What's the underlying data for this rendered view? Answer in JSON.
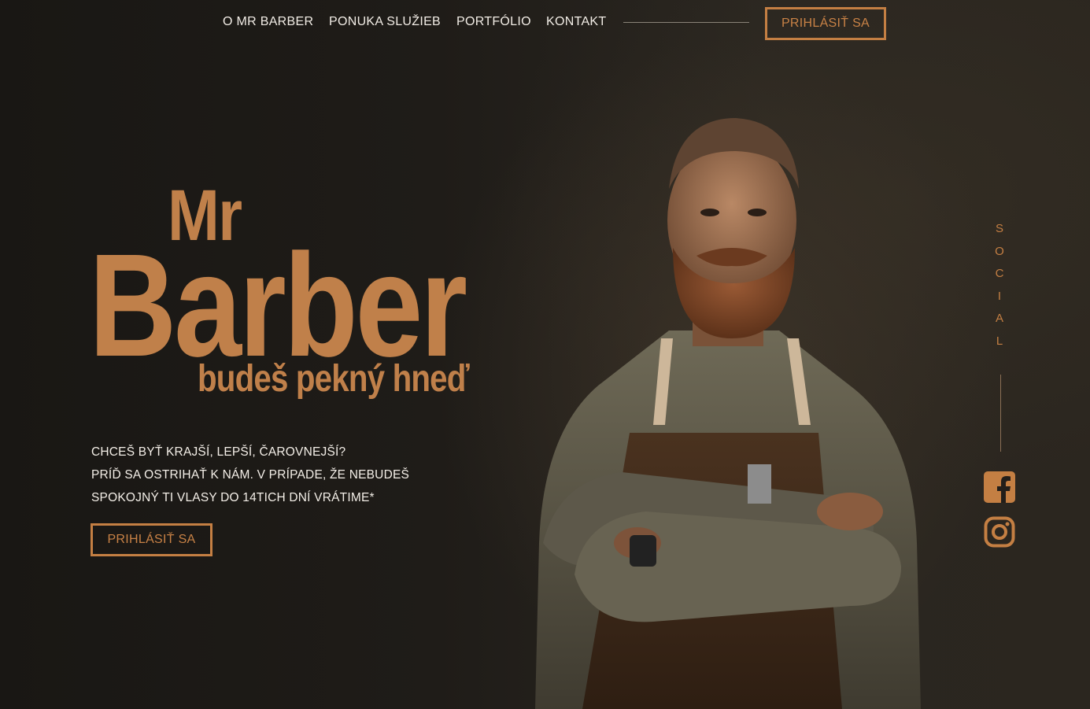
{
  "nav": {
    "links": [
      {
        "label": "O MR BARBER"
      },
      {
        "label": "PONUKA SLUŽIEB"
      },
      {
        "label": "PORTFÓLIO"
      },
      {
        "label": "KONTAKT"
      }
    ],
    "login_label": "PRIHLÁSIŤ SA"
  },
  "hero": {
    "title_small": "Mr",
    "title_big": "Barber",
    "subtitle": "budeš pekný hneď",
    "description": [
      "CHCEŠ BYŤ KRAJŠÍ, LEPŠÍ, ČAROVNEJŠÍ?",
      "PRÍĎ SA OSTRIHAŤ K NÁM. V PRÍPADE, ŽE NEBUDEŠ",
      "SPOKOJNÝ TI VLASY DO 14TICH DNÍ VRÁTIME*"
    ],
    "cta_label": "PRIHLÁSIŤ SA"
  },
  "social": {
    "label_letters": [
      "S",
      "O",
      "C",
      "I",
      "A",
      "L"
    ],
    "icons": [
      "facebook-icon",
      "instagram-icon"
    ]
  },
  "colors": {
    "accent": "#c47f43",
    "background": "#1e1b17",
    "text": "#f2ede6"
  }
}
